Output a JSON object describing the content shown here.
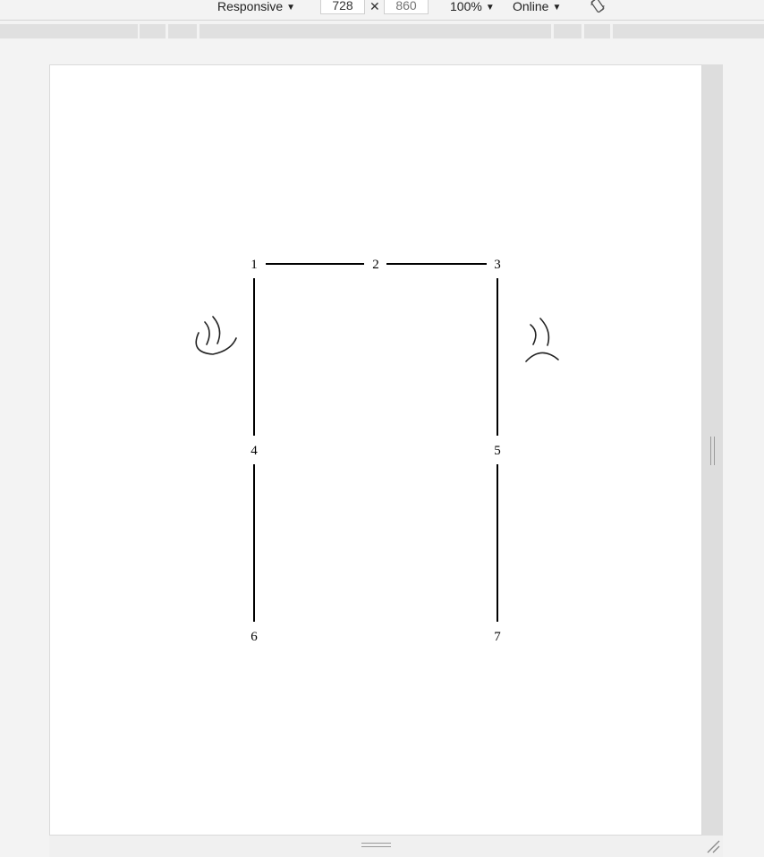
{
  "toolbar": {
    "device_label": "Responsive",
    "width_value": "728",
    "height_placeholder": "860",
    "dimension_separator": "✕",
    "zoom_label": "100%",
    "throttle_label": "Online",
    "rotate_icon": "rotate-icon"
  },
  "page": {
    "graph": {
      "nodes": [
        {
          "id": "n1",
          "label": "1"
        },
        {
          "id": "n2",
          "label": "2"
        },
        {
          "id": "n3",
          "label": "3"
        },
        {
          "id": "n4",
          "label": "4"
        },
        {
          "id": "n5",
          "label": "5"
        },
        {
          "id": "n6",
          "label": "6"
        },
        {
          "id": "n7",
          "label": "7"
        }
      ],
      "edges": [
        [
          "1",
          "2"
        ],
        [
          "2",
          "3"
        ],
        [
          "1",
          "4"
        ],
        [
          "3",
          "5"
        ],
        [
          "4",
          "6"
        ],
        [
          "5",
          "7"
        ]
      ],
      "faces": {
        "left": "smiley-face-icon",
        "right": "sad-face-icon"
      }
    }
  }
}
